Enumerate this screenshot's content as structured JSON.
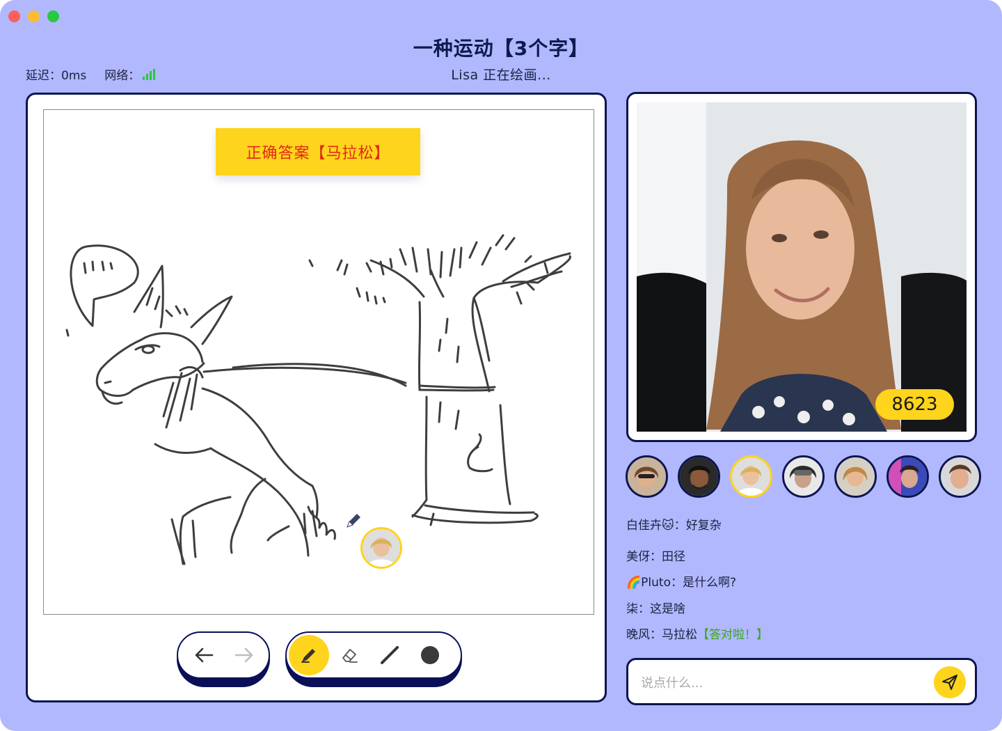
{
  "window": {
    "traffic_lights": {
      "close": "#fe5f57",
      "minimize": "#febc2e",
      "zoom": "#28c840"
    }
  },
  "header": {
    "title": "一种运动【3个字】",
    "latency_label": "延迟：0ms",
    "network_label": "网络：",
    "network_icon": "signal-bars-icon",
    "drawer_status": "Lisa 正在绘画..."
  },
  "board": {
    "answer_banner": "正确答案【马拉松】"
  },
  "toolbar": {
    "history": [
      {
        "name": "undo",
        "icon": "arrow-left-icon"
      },
      {
        "name": "redo",
        "icon": "arrow-right-icon",
        "disabled": true
      }
    ],
    "tools": [
      {
        "name": "pen",
        "icon": "pen-icon",
        "active": true
      },
      {
        "name": "eraser",
        "icon": "eraser-icon"
      },
      {
        "name": "line",
        "icon": "line-icon"
      },
      {
        "name": "fill",
        "icon": "circle-icon"
      }
    ]
  },
  "video": {
    "score": "8623"
  },
  "players": [
    {
      "name": "player-1"
    },
    {
      "name": "player-2"
    },
    {
      "name": "player-3",
      "current": true
    },
    {
      "name": "player-4"
    },
    {
      "name": "player-5"
    },
    {
      "name": "player-6"
    },
    {
      "name": "player-7"
    }
  ],
  "chat": {
    "messages": [
      {
        "text": "白佳卉🐱：好复杂"
      },
      {
        "text": "美伢：田径"
      },
      {
        "text": "🌈Pluto：是什么啊?"
      },
      {
        "text": "柒：这是啥"
      },
      {
        "text": "晚风：马拉松",
        "suffix": "【答对啦！】"
      }
    ],
    "placeholder": "说点什么..."
  },
  "colors": {
    "background": "#b1b8fe",
    "accent": "#fed41c",
    "border": "#0d1550",
    "answer_text": "#e02a14",
    "correct_text": "#3aa51c"
  }
}
